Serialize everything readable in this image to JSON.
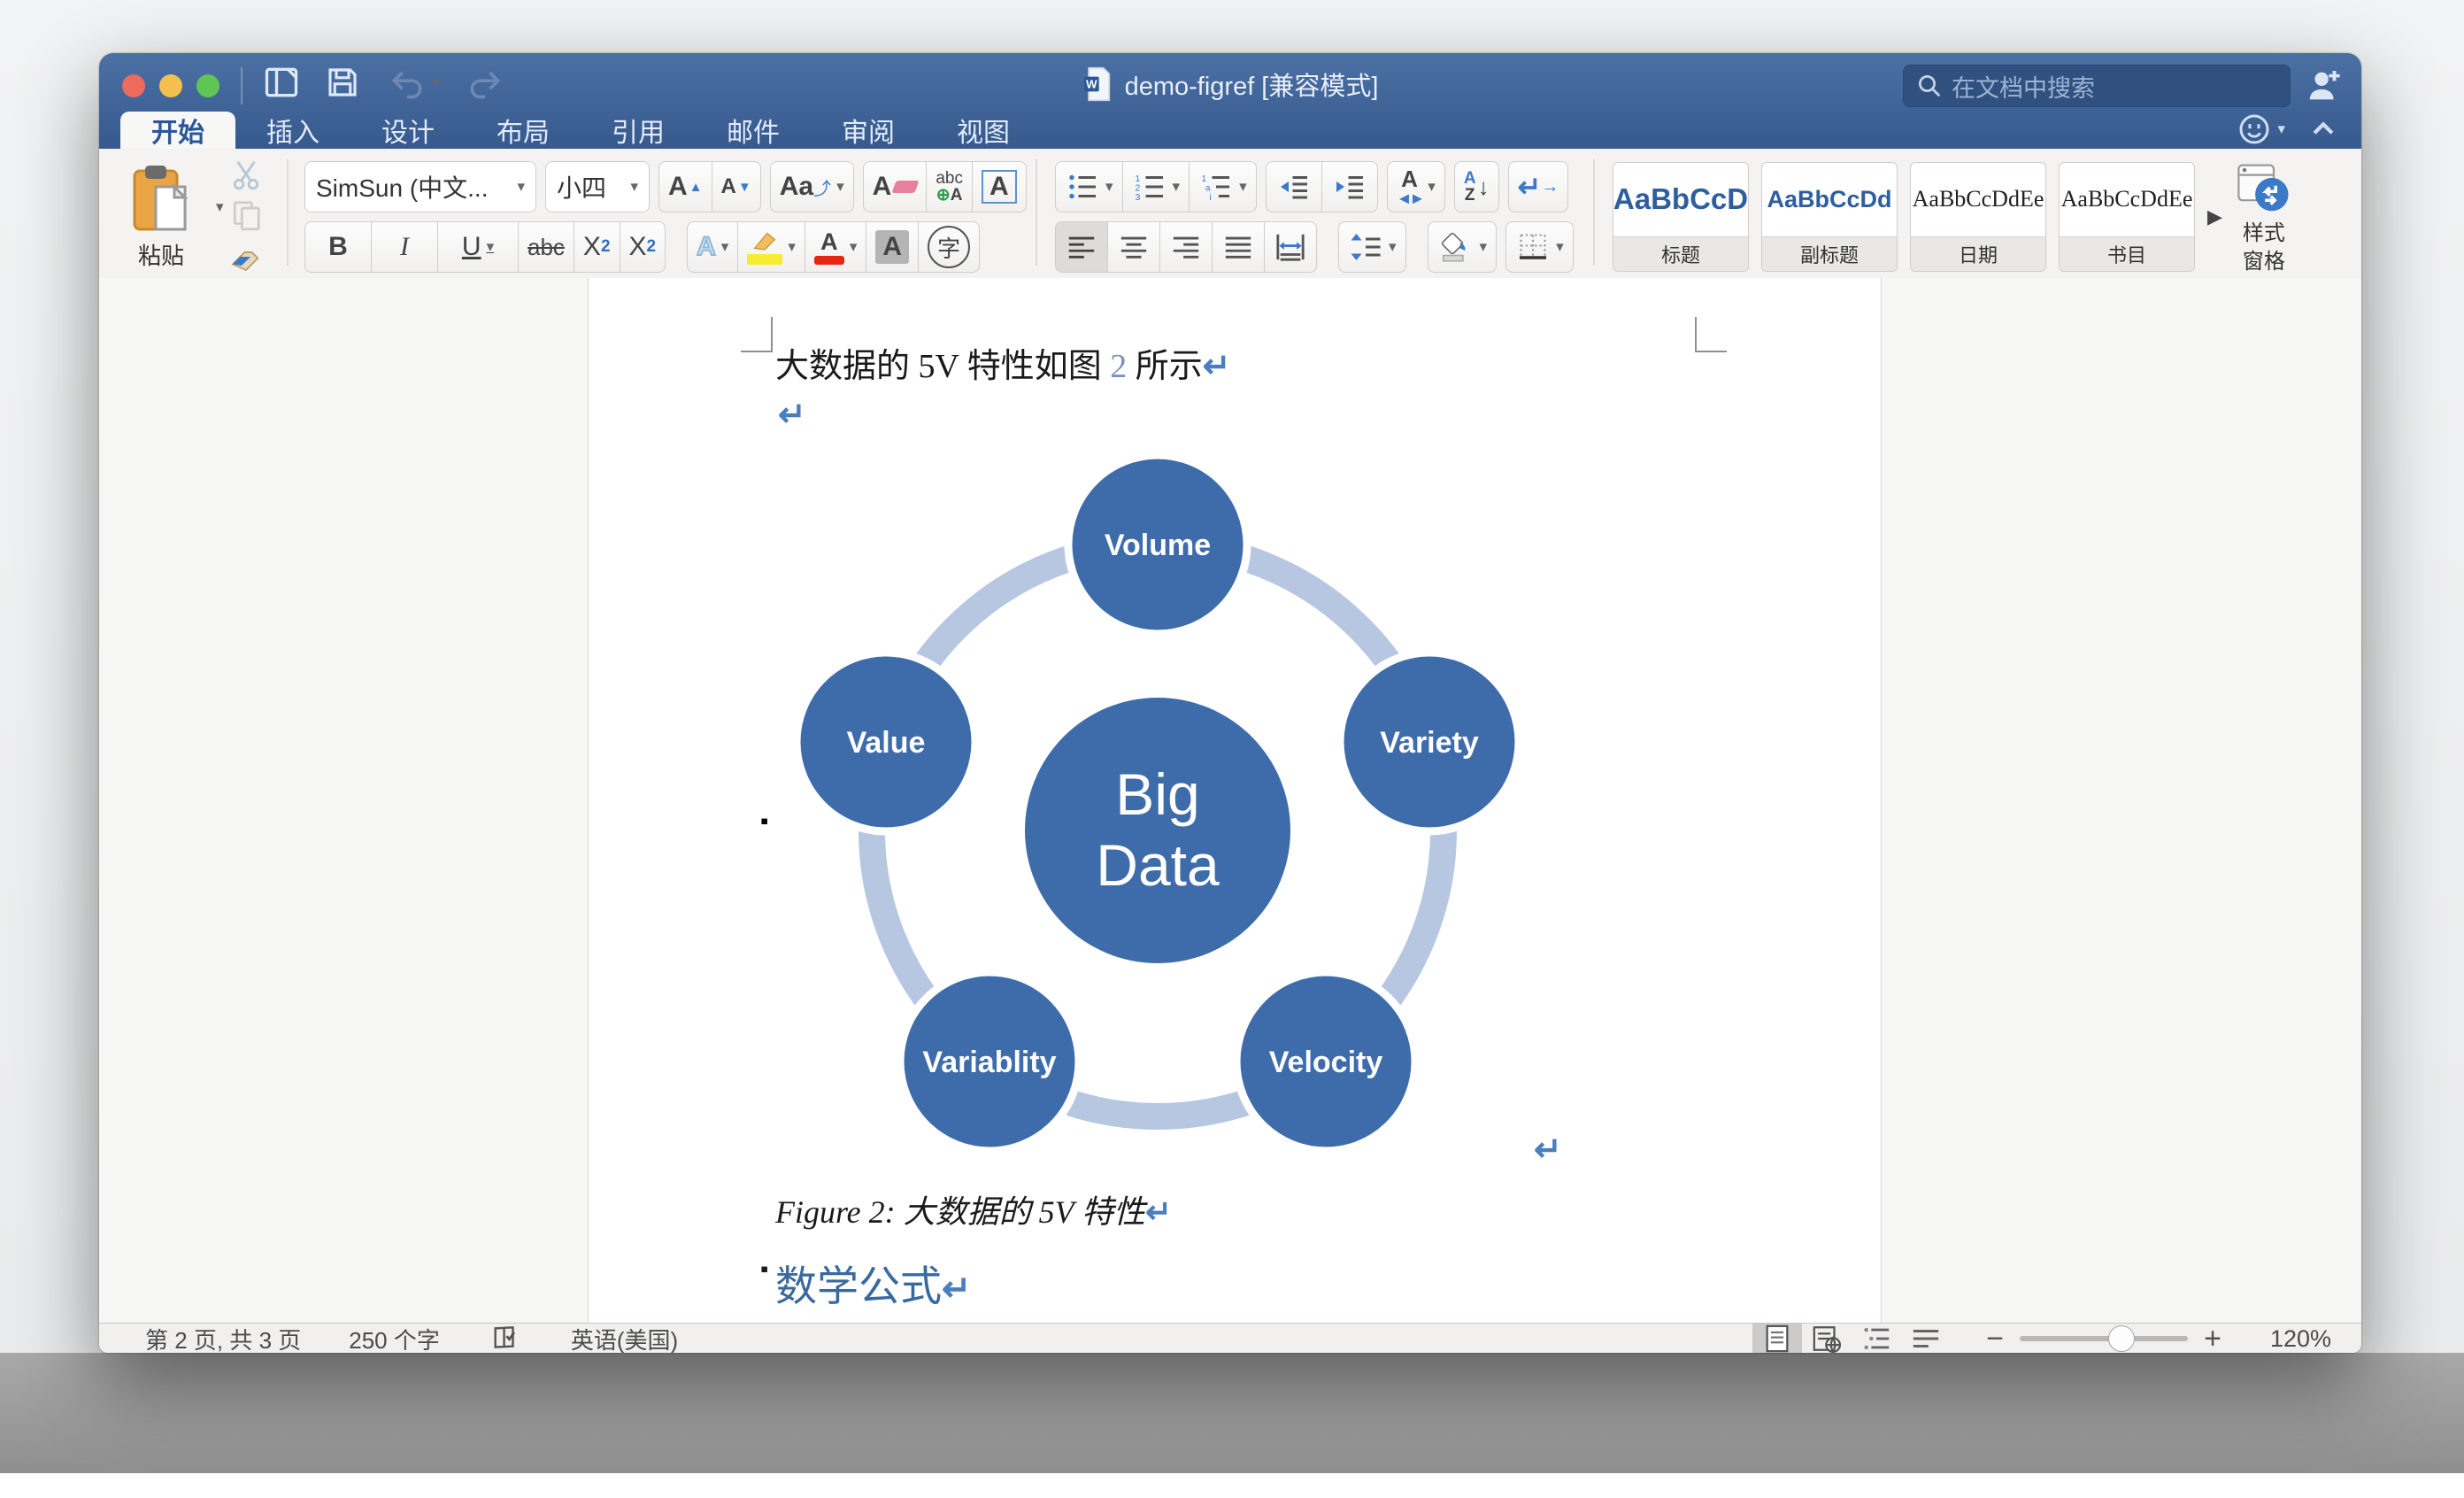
{
  "window": {
    "title": "demo-figref [兼容模式]",
    "search_placeholder": "在文档中搜索",
    "tabs": [
      {
        "label": "开始"
      },
      {
        "label": "插入"
      },
      {
        "label": "设计"
      },
      {
        "label": "布局"
      },
      {
        "label": "引用"
      },
      {
        "label": "邮件"
      },
      {
        "label": "审阅"
      },
      {
        "label": "视图"
      }
    ]
  },
  "ribbon": {
    "paste_label": "粘贴",
    "font_name": "SimSun (中文...",
    "font_size": "小四",
    "buttons": {
      "grow": "A",
      "shrink": "A",
      "case": "Aa",
      "clear": "A",
      "phonetic_top": "abc",
      "phonetic_bottom": "A",
      "char_border": "A",
      "bold": "B",
      "italic": "I",
      "underline": "U",
      "strike": "abc",
      "sub_base": "X",
      "sub_script": "2",
      "sup_base": "X",
      "sup_script": "2",
      "text_effect": "A",
      "font_color": "A",
      "char_shade": "A",
      "enclose": "字",
      "sort_a": "A",
      "sort_z": "Z",
      "direction": "A"
    },
    "styles": [
      {
        "sample": "AaBbCcD",
        "label": "标题"
      },
      {
        "sample": "AaBbCcDd",
        "label": "副标题"
      },
      {
        "sample": "AaBbCcDdEe",
        "label": "日期"
      },
      {
        "sample": "AaBbCcDdEe",
        "label": "书目"
      }
    ],
    "style_pane": {
      "line1": "样式",
      "line2": "窗格"
    }
  },
  "document": {
    "para1_before": "大数据的 5V 特性如图 ",
    "para1_ref": "2",
    "para1_after": " 所示",
    "caption": "Figure 2: 大数据的 5V 特性",
    "heading": "数学公式"
  },
  "diagram": {
    "center_line1": "Big",
    "center_line2": "Data",
    "satellites": [
      {
        "label": "Volume"
      },
      {
        "label": "Variety"
      },
      {
        "label": "Velocity"
      },
      {
        "label": "Variablity"
      },
      {
        "label": "Value"
      }
    ],
    "circle_color": "#3e6cab",
    "ring_color": "#b7c7e2"
  },
  "status_bar": {
    "page_info": "第 2 页, 共 3 页",
    "word_count": "250 个字",
    "language": "英语(美国)",
    "zoom_level": "120%"
  },
  "icons": {
    "caret": "▾",
    "return_mark": "↵",
    "expand_arrow": "▶",
    "anchor": "▪",
    "zoom_in": "+",
    "zoom_out": "−"
  },
  "colors": {
    "titlebar_blue": "#3f659a",
    "accent_blue": "#2b579a",
    "diagram_blue": "#3e6cab",
    "ring_blue": "#b7c7e2",
    "heading_blue": "#38699f"
  }
}
